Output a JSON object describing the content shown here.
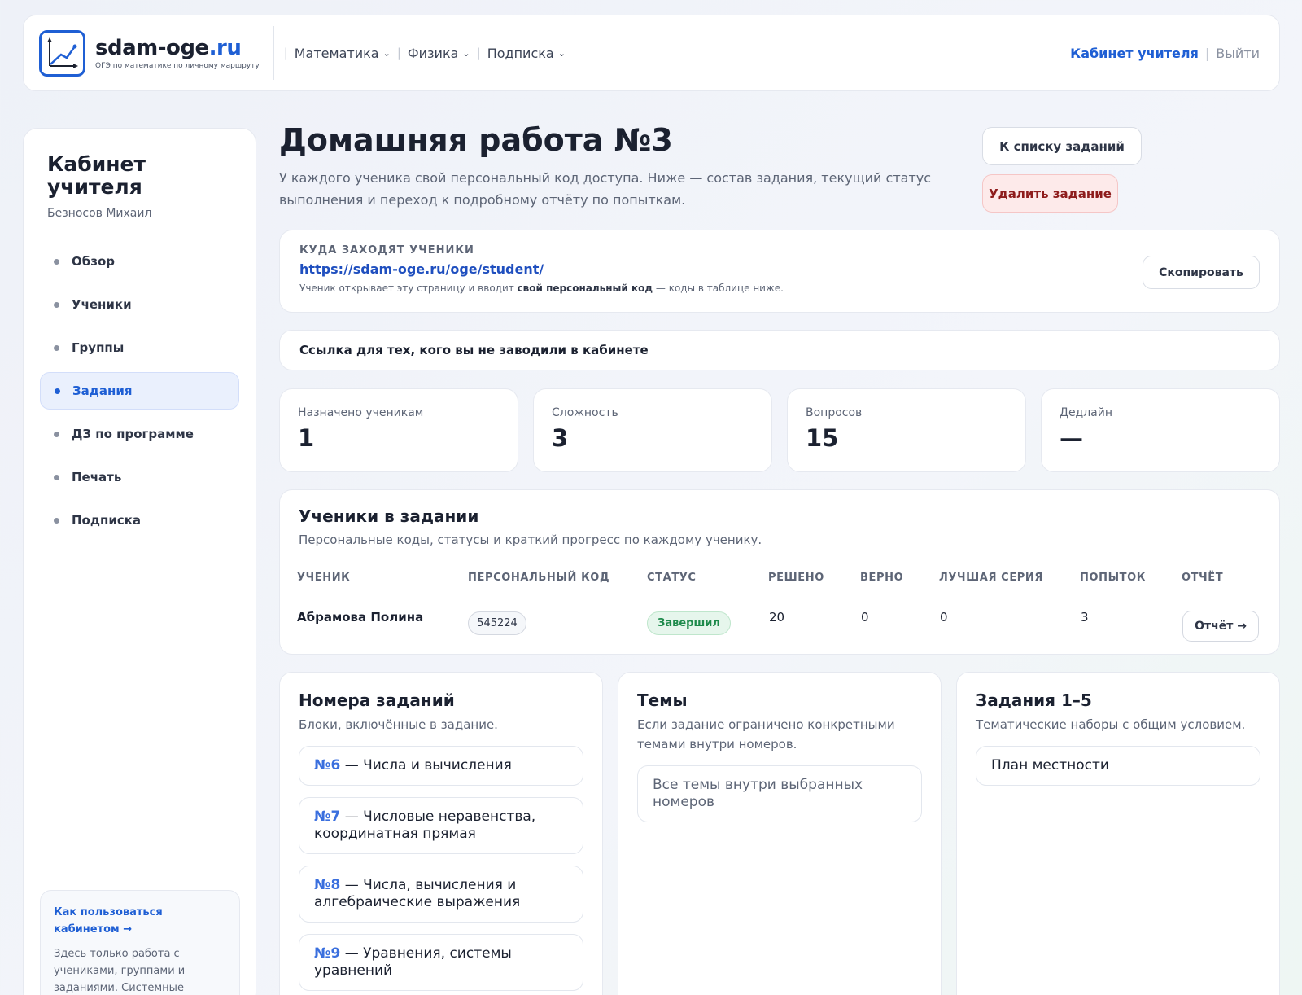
{
  "header": {
    "logo_name_main": "sdam-oge",
    "logo_name_tld": ".ru",
    "logo_sub": "ОГЭ по математике по личному маршруту",
    "nav": [
      "Математика",
      "Физика",
      "Подписка"
    ],
    "cabinet_link": "Кабинет учителя",
    "sep": "|",
    "exit_link": "Выйти"
  },
  "sidebar": {
    "title": "Кабинет учителя",
    "user": "Безносов Михаил",
    "items": [
      "Обзор",
      "Ученики",
      "Группы",
      "Задания",
      "ДЗ по программе",
      "Печать",
      "Подписка"
    ],
    "active_index": 3,
    "help_link": "Как пользоваться кабинетом →",
    "help_text": "Здесь только работа с учениками, группами и заданиями. Системные"
  },
  "page": {
    "title": "Домашняя работа №3",
    "description": "У каждого ученика свой персональный код доступа. Ниже — состав задания, текущий статус выполнения и переход к подробному отчёту по попыткам.",
    "btn_list": "К списку заданий",
    "btn_delete": "Удалить задание"
  },
  "access": {
    "caption": "КУДА ЗАХОДЯТ УЧЕНИКИ",
    "url": "https://sdam-oge.ru/oge/student/",
    "note_before": "Ученик открывает эту страницу и вводит ",
    "note_bold": "свой персональный код",
    "note_after": " — коды в таблице ниже.",
    "copy_button": "Скопировать"
  },
  "guest_link": "Ссылка для тех, кого вы не заводили в кабинете",
  "stats": [
    {
      "label": "Назначено ученикам",
      "value": "1"
    },
    {
      "label": "Сложность",
      "value": "3"
    },
    {
      "label": "Вопросов",
      "value": "15"
    },
    {
      "label": "Дедлайн",
      "value": "—"
    }
  ],
  "students": {
    "title": "Ученики в задании",
    "subtitle": "Персональные коды, статусы и краткий прогресс по каждому ученику.",
    "columns": [
      "УЧЕНИК",
      "ПЕРСОНАЛЬНЫЙ КОД",
      "СТАТУС",
      "РЕШЕНО",
      "ВЕРНО",
      "ЛУЧШАЯ СЕРИЯ",
      "ПОПЫТОК",
      "ОТЧЁТ"
    ],
    "rows": [
      {
        "name": "Абрамова Полина",
        "code": "545224",
        "status": "Завершил",
        "solved": "20",
        "correct": "0",
        "best_streak": "0",
        "attempts": "3",
        "report": "Отчёт →"
      }
    ]
  },
  "blocks": {
    "numbers": {
      "title": "Номера заданий",
      "subtitle": "Блоки, включённые в задание.",
      "items": [
        {
          "num": "№6",
          "text": " — Числа и вычисления"
        },
        {
          "num": "№7",
          "text": " — Числовые неравенства, координатная прямая"
        },
        {
          "num": "№8",
          "text": " — Числа, вычисления и алгебраические выражения"
        },
        {
          "num": "№9",
          "text": " — Уравнения, системы уравнений"
        }
      ]
    },
    "topics": {
      "title": "Темы",
      "subtitle": "Если задание ограничено конкретными темами внутри номеров.",
      "items": [
        "Все темы внутри выбранных номеров"
      ]
    },
    "tasks15": {
      "title": "Задания 1–5",
      "subtitle": "Тематические наборы с общим условием.",
      "items": [
        "План местности"
      ]
    }
  },
  "colors": {
    "accent": "#1f5fd4",
    "success": "#1e8a4b",
    "danger": "#8e1c1c"
  }
}
